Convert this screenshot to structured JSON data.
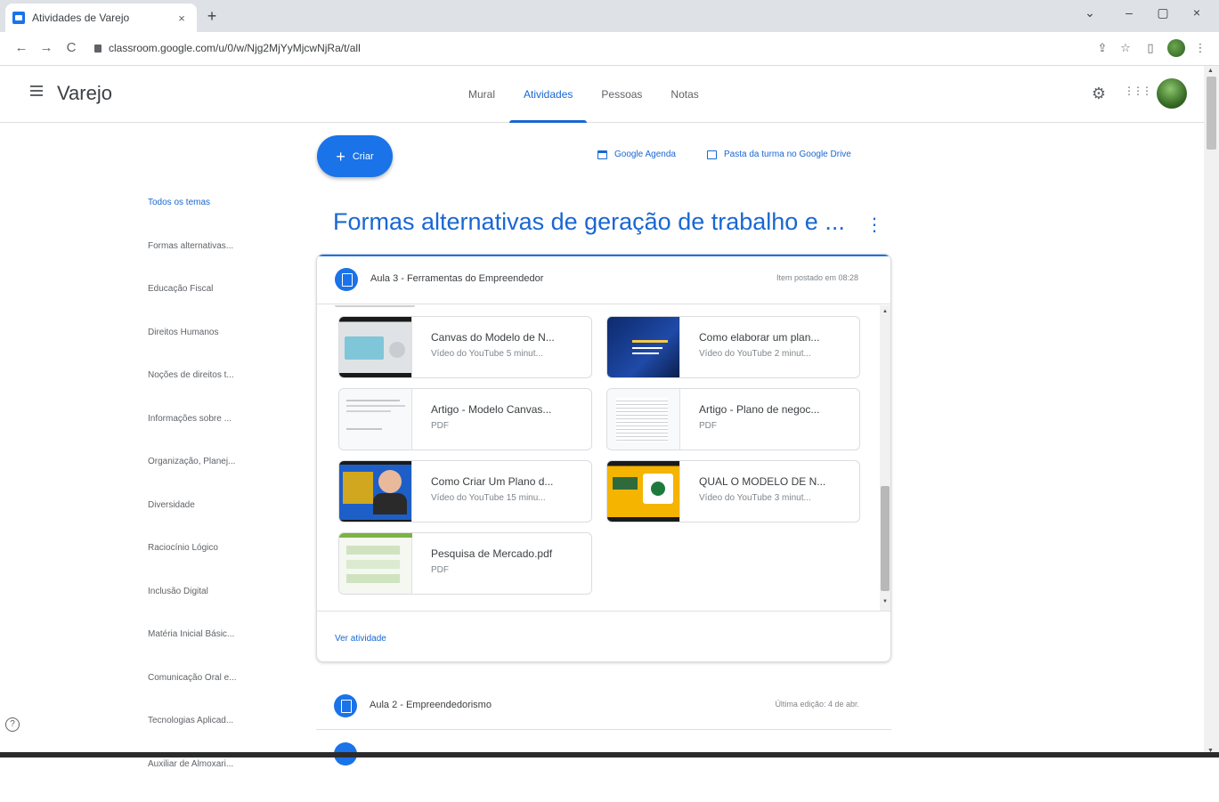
{
  "browser": {
    "tab_title": "Atividades de Varejo",
    "tab_close": "×",
    "new_tab": "+",
    "window_controls": {
      "expand": "⌄",
      "minimize": "–",
      "maximize": "▢",
      "close": "×"
    },
    "url": "classroom.google.com/u/0/w/Njg2MjYyMjcwNjRa/t/all",
    "nav": {
      "back": "←",
      "forward": "→",
      "reload": "C"
    },
    "right_icons": {
      "share": "⇪",
      "star": "☆",
      "sidepanel": "▯",
      "menu": "⋮"
    }
  },
  "header": {
    "menu_icon": "menu-icon",
    "class_name": "Varejo",
    "tabs": [
      {
        "label": "Mural",
        "active": false
      },
      {
        "label": "Atividades",
        "active": true
      },
      {
        "label": "Pessoas",
        "active": false
      },
      {
        "label": "Notas",
        "active": false
      }
    ],
    "settings_glyph": "⚙",
    "apps_glyph": "⋮⋮⋮"
  },
  "toolbar": {
    "create_plus": "+",
    "create_label": "Criar",
    "calendar_link": "Google Agenda",
    "drive_link": "Pasta da turma no Google Drive"
  },
  "sidebar": {
    "topics": [
      "Todos os temas",
      "Formas alternativas...",
      "Educação Fiscal",
      "Direitos Humanos",
      "Noções de direitos t...",
      "Informações sobre ...",
      "Organização, Planej...",
      "Diversidade",
      "Raciocínio Lógico",
      "Inclusão Digital",
      "Matéria Inicial Básic...",
      "Comunicação Oral e...",
      "Tecnologias Aplicad...",
      "Auxiliar de Almoxari..."
    ],
    "help_glyph": "?"
  },
  "main": {
    "topic_title": "Formas alternativas de geração de trabalho e ...",
    "topic_more": "⋮",
    "assignment": {
      "title": "Aula 3 - Ferramentas do Empreendedor",
      "meta": "Item postado em 08:28",
      "attachments": [
        {
          "title": "Canvas do Modelo de N...",
          "sub": "Vídeo do YouTube  5 minut..."
        },
        {
          "title": "Como elaborar um plan...",
          "sub": "Vídeo do YouTube  2 minut..."
        },
        {
          "title": "Artigo - Modelo Canvas...",
          "sub": "PDF"
        },
        {
          "title": "Artigo - Plano de negoc...",
          "sub": "PDF"
        },
        {
          "title": "Como Criar Um Plano d...",
          "sub": "Vídeo do YouTube  15 minu..."
        },
        {
          "title": "QUAL O MODELO DE N...",
          "sub": "Vídeo do YouTube  3 minut..."
        },
        {
          "title": "Pesquisa de Mercado.pdf",
          "sub": "PDF"
        }
      ],
      "view_link": "Ver atividade"
    },
    "next_assignment": {
      "title": "Aula 2 - Empreendedorismo",
      "meta": "Última edição: 4 de abr."
    }
  },
  "colors": {
    "accent": "#1a73e8",
    "active_tab": "#1967d2",
    "chrome_bg": "#dee1e6"
  }
}
